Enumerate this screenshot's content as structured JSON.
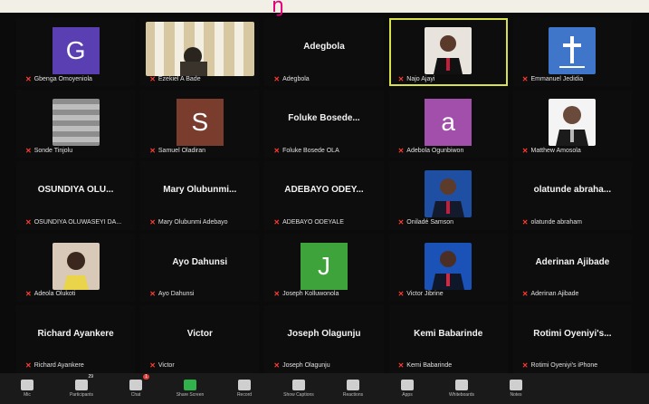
{
  "top_glyph": "ŋ",
  "tiles": [
    {
      "type": "letter",
      "letter": "G",
      "color": "#5a3fb2",
      "name": "Gbenga Omoyeniola"
    },
    {
      "type": "photo",
      "photo": "curtain",
      "name": "Ezekiel A Bade"
    },
    {
      "type": "text",
      "title": "Adegbola",
      "name": "Adegbola"
    },
    {
      "type": "photo",
      "photo": "man-suit",
      "active": true,
      "name": "Najo Ajayi"
    },
    {
      "type": "photo",
      "photo": "cross-logo",
      "name": "Emmanuel Jedidia"
    },
    {
      "type": "photo",
      "photo": "roof",
      "name": "Sonde Tinjolu"
    },
    {
      "type": "letter",
      "letter": "S",
      "color": "#7a3d2d",
      "name": "Samuel Oladiran"
    },
    {
      "type": "text",
      "title": "Foluke Bosede...",
      "name": "Foluke Bosede OLA"
    },
    {
      "type": "letter",
      "letter": "a",
      "color": "#a24eab",
      "name": "Adebola Ogunbiwon"
    },
    {
      "type": "photo",
      "photo": "man-bald",
      "name": "Matthew Amosola"
    },
    {
      "type": "text",
      "title": "OSUNDIYA OLU...",
      "name": "OSUNDIYA OLUWASEYI DA..."
    },
    {
      "type": "text",
      "title": "Mary Olubunmi...",
      "name": "Mary Olubunmi Adebayo"
    },
    {
      "type": "text",
      "title": "ADEBAYO ODEY...",
      "name": "ADEBAYO ODEYALE"
    },
    {
      "type": "photo",
      "photo": "man-blue",
      "name": "Oniladé Samson"
    },
    {
      "type": "text",
      "title": "olatunde abraha...",
      "name": "olatunde abraham"
    },
    {
      "type": "photo",
      "photo": "woman",
      "name": "Adeola Olukoti"
    },
    {
      "type": "text",
      "title": "Ayo Dahunsi",
      "name": "Ayo Dahunsi"
    },
    {
      "type": "letter",
      "letter": "J",
      "color": "#3ea33b",
      "name": "Joseph Kolluwonola"
    },
    {
      "type": "photo",
      "photo": "man-red",
      "name": "Victor Jibrine"
    },
    {
      "type": "text",
      "title": "Aderinan Ajibade",
      "name": "Aderinan Ajibade"
    },
    {
      "type": "text",
      "title": "Richard Ayankere",
      "name": "Richard Ayankere"
    },
    {
      "type": "text",
      "title": "Victor",
      "name": "Victor"
    },
    {
      "type": "text",
      "title": "Joseph Olagunju",
      "name": "Joseph Olagunju"
    },
    {
      "type": "text",
      "title": "Kemi Babarinde",
      "name": "Kemi Babarinde"
    },
    {
      "type": "text",
      "title": "Rotimi Oyeniyi's...",
      "name": "Rotimi Oyeniyi's iPhone"
    }
  ],
  "toolbar": [
    {
      "id": "audio",
      "label": "Mic",
      "icon": "mic-icon"
    },
    {
      "id": "participants",
      "label": "Participants",
      "icon": "participants-icon",
      "count": "29"
    },
    {
      "id": "chat",
      "label": "Chat",
      "icon": "chat-icon",
      "badge": "1"
    },
    {
      "id": "share",
      "label": "Share Screen",
      "icon": "share-screen-icon",
      "green": true
    },
    {
      "id": "record",
      "label": "Record",
      "icon": "record-icon"
    },
    {
      "id": "captions",
      "label": "Show Captions",
      "icon": "captions-icon"
    },
    {
      "id": "reactions",
      "label": "Reactions",
      "icon": "reactions-icon"
    },
    {
      "id": "apps",
      "label": "Apps",
      "icon": "apps-icon"
    },
    {
      "id": "whiteboards",
      "label": "Whiteboards",
      "icon": "whiteboard-icon"
    },
    {
      "id": "notes",
      "label": "Notes",
      "icon": "notes-icon"
    }
  ]
}
